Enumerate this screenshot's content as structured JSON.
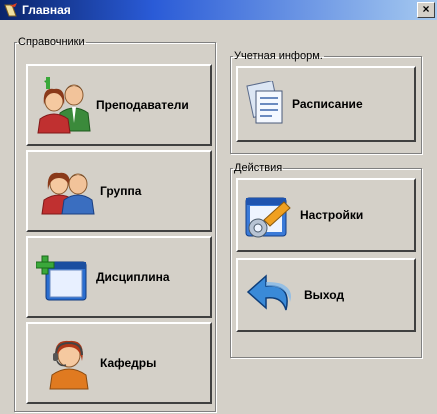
{
  "window": {
    "title": "Главная",
    "close_glyph": "×"
  },
  "groups": {
    "references": {
      "legend": "Справочники",
      "buttons": [
        {
          "label": "Преподаватели",
          "icon": "teachers-icon"
        },
        {
          "label": "Группа",
          "icon": "group-icon"
        },
        {
          "label": "Дисциплина",
          "icon": "discipline-icon"
        },
        {
          "label": "Кафедры",
          "icon": "departments-icon"
        }
      ]
    },
    "account": {
      "legend": "Учетная информ.",
      "buttons": [
        {
          "label": "Расписание",
          "icon": "schedule-icon"
        }
      ]
    },
    "actions": {
      "legend": "Действия",
      "buttons": [
        {
          "label": "Настройки",
          "icon": "settings-icon"
        },
        {
          "label": "Выход",
          "icon": "exit-icon"
        }
      ]
    }
  }
}
